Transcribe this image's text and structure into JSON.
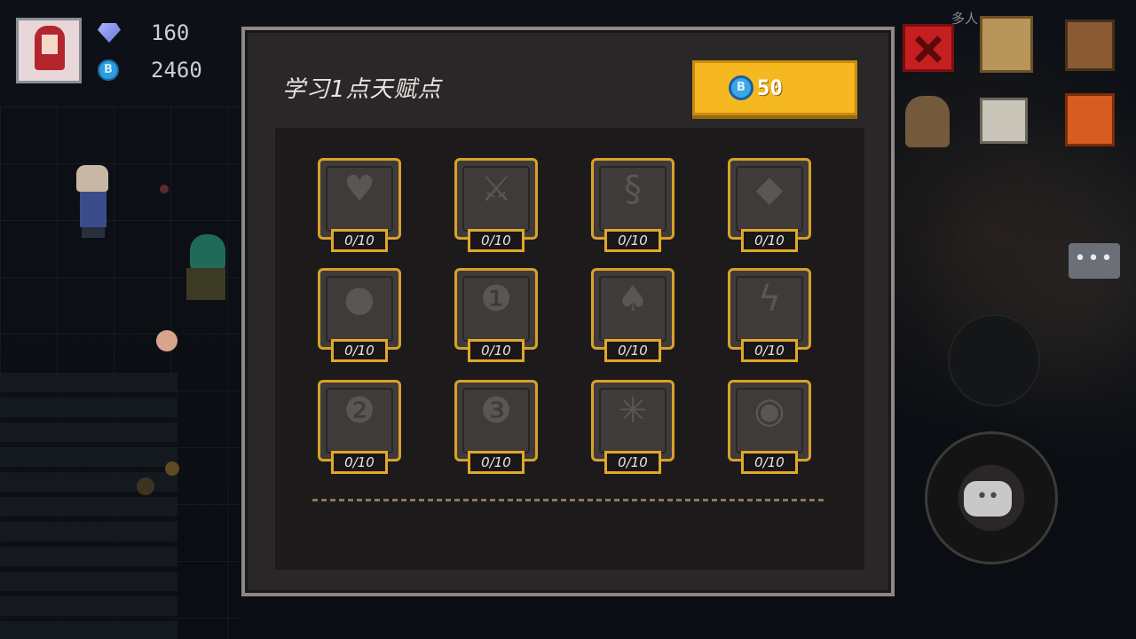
{
  "player": {
    "gems": "160",
    "coins": "2460"
  },
  "hud": {
    "multiplayer_label": "多人",
    "chat_dots": "•••",
    "joystick_dots": "••",
    "coin_glyph": "B"
  },
  "talent_panel": {
    "title": "学习1点天赋点",
    "cost": "50",
    "talents": [
      {
        "icon": "heart-icon",
        "glyph": "♥",
        "level": "0/10"
      },
      {
        "icon": "sword-icon",
        "glyph": "⚔",
        "level": "0/10"
      },
      {
        "icon": "swirl-icon",
        "glyph": "§",
        "level": "0/10"
      },
      {
        "icon": "drop-icon",
        "glyph": "◆",
        "level": "0/10"
      },
      {
        "icon": "potion-icon",
        "glyph": "●",
        "level": "0/10"
      },
      {
        "icon": "number-one-icon",
        "glyph": "❶",
        "level": "0/10"
      },
      {
        "icon": "hood-icon",
        "glyph": "♠",
        "level": "0/10"
      },
      {
        "icon": "lightning-icon",
        "glyph": "ϟ",
        "level": "0/10"
      },
      {
        "icon": "number-two-icon",
        "glyph": "❷",
        "level": "0/10"
      },
      {
        "icon": "number-three-icon",
        "glyph": "❸",
        "level": "0/10"
      },
      {
        "icon": "spark-icon",
        "glyph": "✳",
        "level": "0/10"
      },
      {
        "icon": "eye-icon",
        "glyph": "◉",
        "level": "0/10"
      }
    ]
  },
  "colors": {
    "accent_gold": "#f5b820",
    "frame_gold": "#d8a12a",
    "close_red": "#c51f20"
  }
}
